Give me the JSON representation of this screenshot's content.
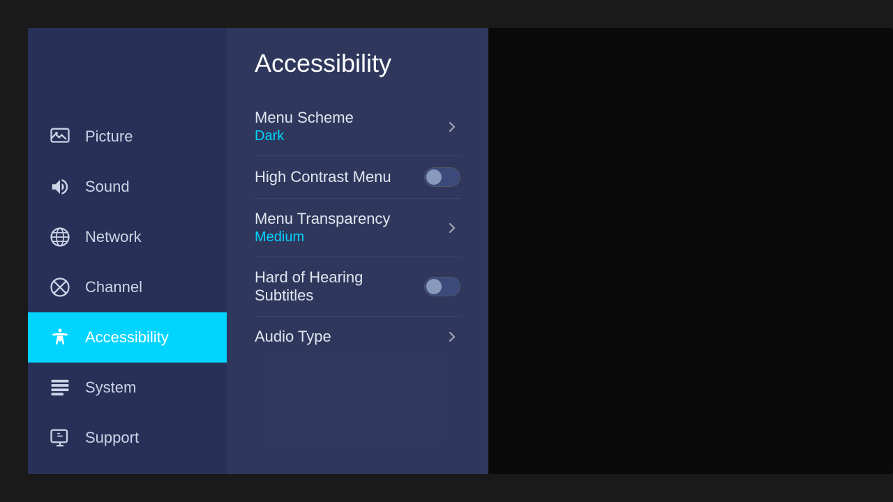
{
  "page": {
    "title": "Accessibility"
  },
  "sidebar": {
    "items": [
      {
        "id": "picture",
        "label": "Picture",
        "active": false
      },
      {
        "id": "sound",
        "label": "Sound",
        "active": false
      },
      {
        "id": "network",
        "label": "Network",
        "active": false
      },
      {
        "id": "channel",
        "label": "Channel",
        "active": false
      },
      {
        "id": "accessibility",
        "label": "Accessibility",
        "active": true
      },
      {
        "id": "system",
        "label": "System",
        "active": false
      },
      {
        "id": "support",
        "label": "Support",
        "active": false
      }
    ]
  },
  "menu": {
    "items": [
      {
        "id": "menu-scheme",
        "label": "Menu Scheme",
        "value": "Dark",
        "type": "arrow",
        "toggle": null
      },
      {
        "id": "high-contrast-menu",
        "label": "High Contrast Menu",
        "value": null,
        "type": "toggle",
        "toggle": "off"
      },
      {
        "id": "menu-transparency",
        "label": "Menu Transparency",
        "value": "Medium",
        "type": "arrow",
        "toggle": null
      },
      {
        "id": "hard-of-hearing-subtitles",
        "label": "Hard of Hearing Subtitles",
        "value": null,
        "type": "toggle",
        "toggle": "off"
      },
      {
        "id": "audio-type",
        "label": "Audio Type",
        "value": null,
        "type": "arrow",
        "toggle": null
      }
    ]
  },
  "colors": {
    "accent": "#00d4ff",
    "sidebar_bg": "rgba(40,50,90,0.95)",
    "main_bg": "rgba(50,60,100,0.9)",
    "active_item": "#00d4ff"
  }
}
